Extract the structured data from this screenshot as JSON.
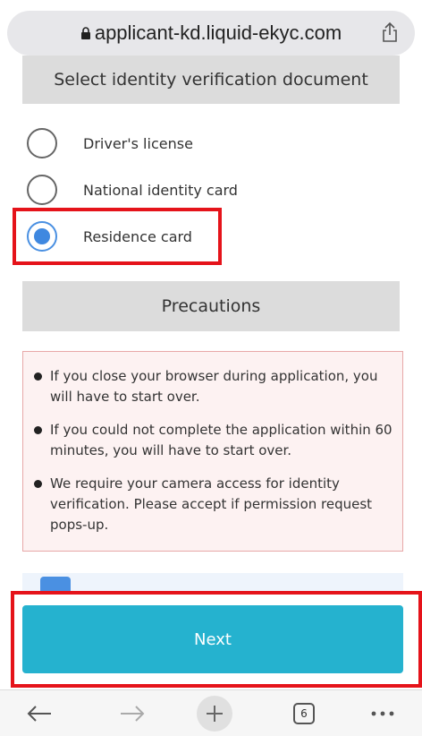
{
  "browser": {
    "url": "applicant-kd.liquid-ekyc.com",
    "tab_count": "6"
  },
  "document_section": {
    "title": "Select identity verification document",
    "options": [
      {
        "label": "Driver's license",
        "selected": false
      },
      {
        "label": "National identity card",
        "selected": false
      },
      {
        "label": "Residence card",
        "selected": true
      }
    ]
  },
  "precautions_section": {
    "title": "Precautions",
    "items": [
      "If you close your browser during application, you will have to start over.",
      "If you could not complete the application within 60 minutes, you will have to start over.",
      "We require your camera access for identity verification. Please accept if permission request pops-up."
    ]
  },
  "actions": {
    "next_label": "Next"
  },
  "colors": {
    "accent": "#25b2cf",
    "radio_selected": "#3f88e0",
    "highlight": "#e5131a",
    "precaution_bg": "#fdf2f2"
  }
}
